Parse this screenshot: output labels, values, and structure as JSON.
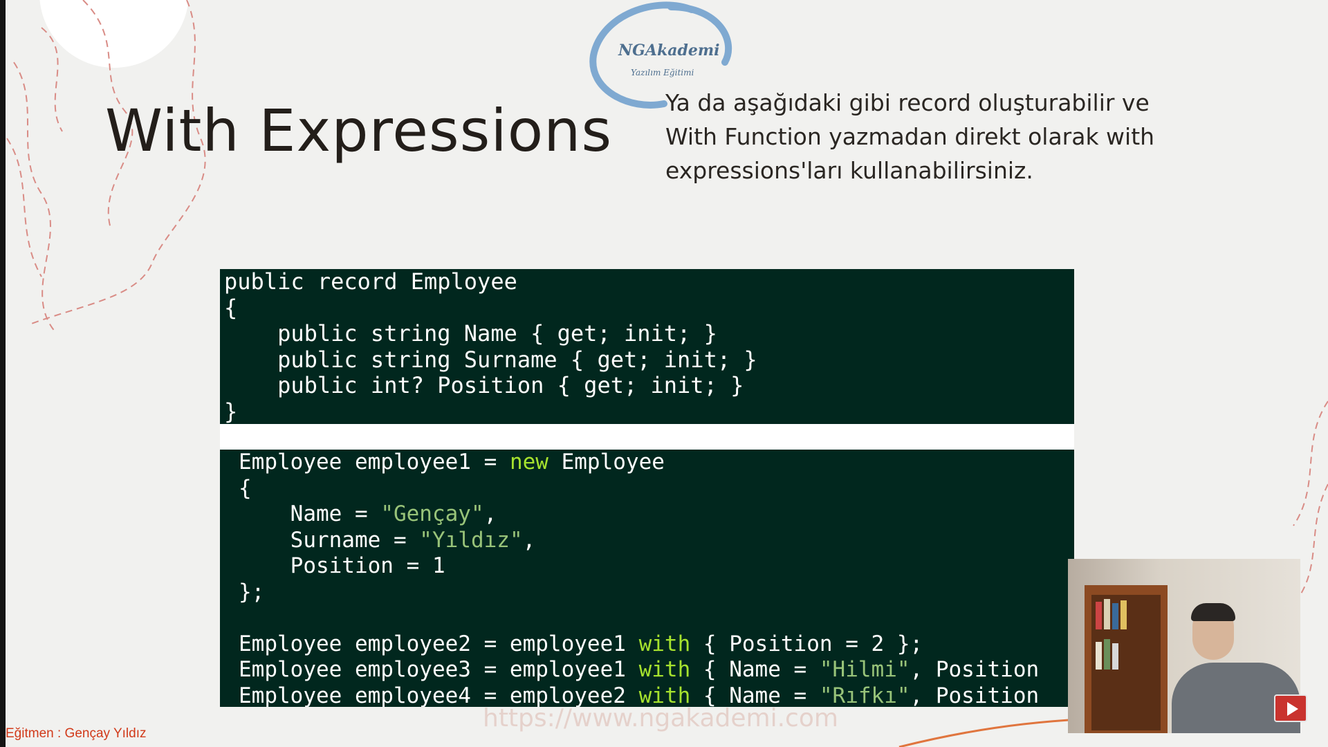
{
  "slide": {
    "title": "With Expressions",
    "description": "Ya da aşağıdaki gibi record oluşturabilir ve With Function yazmadan direkt olarak with expressions'ları kullanabilirsiniz.",
    "logo": {
      "main": "NGAkademi",
      "sub": "Yazılım Eğitimi"
    }
  },
  "code_block_1": [
    "public record Employee",
    "{",
    "    public string Name { get; init; }",
    "    public string Surname { get; init; }",
    "    public int? Position { get; init; }",
    "}"
  ],
  "code_block_2": {
    "line1_a": "Employee employee1 = ",
    "line1_kw": "new",
    "line1_b": " Employee",
    "line2": "{",
    "line3_a": "    Name = ",
    "line3_str": "\"Gençay\"",
    "line3_b": ",",
    "line4_a": "    Surname = ",
    "line4_str": "\"Yıldız\"",
    "line4_b": ",",
    "line5": "    Position = 1",
    "line6": "};",
    "line7": "",
    "line8_a": "Employee employee2 = employee1 ",
    "line8_kw": "with",
    "line8_b": " { Position = 2 };",
    "line9_a": "Employee employee3 = employee1 ",
    "line9_kw": "with",
    "line9_b": " { Name = ",
    "line9_str": "\"Hilmi\"",
    "line9_c": ", Position",
    "line10_a": "Employee employee4 = employee2 ",
    "line10_kw": "with",
    "line10_b": " { Name = ",
    "line10_str": "\"Rıfkı\"",
    "line10_c": ", Position"
  },
  "overlay": {
    "instructor": "Eğitmen : Gençay Yıldız",
    "watermark": "https://www.ngakademi.com",
    "play_icon": "play-icon"
  }
}
